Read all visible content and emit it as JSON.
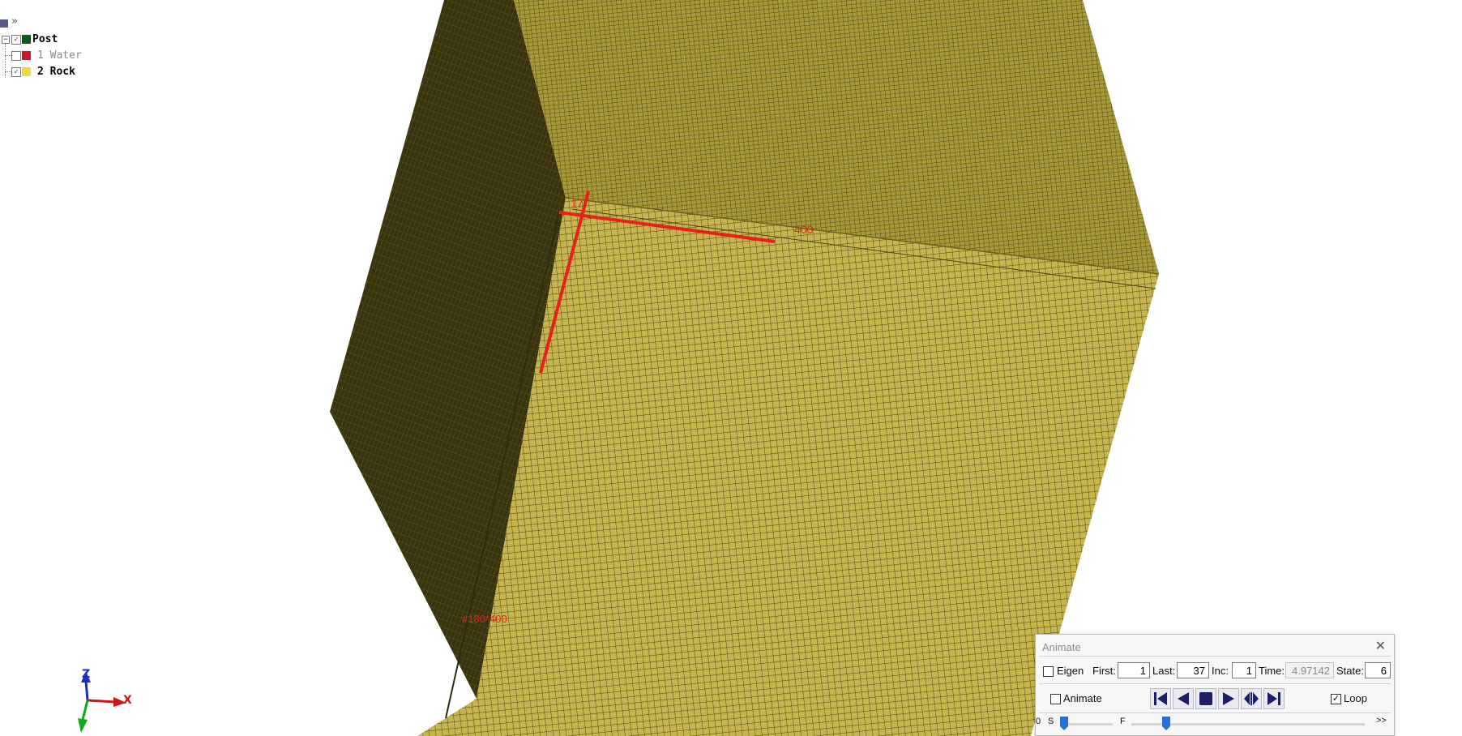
{
  "model_tree": {
    "root": {
      "label": "Post",
      "checked": true,
      "color": "#0a5a10"
    },
    "parts": [
      {
        "label": "1 Water",
        "checked": false,
        "color": "#d01424",
        "visible": false
      },
      {
        "label": "2 Rock",
        "checked": true,
        "color": "#f0dc40",
        "visible": true
      }
    ]
  },
  "annotations": {
    "corner_label": "17",
    "edge_label": "400",
    "bottom_label": "#180*400"
  },
  "axes": {
    "z_label": "Z",
    "x_label": "X",
    "z_color": "#1a2ec8",
    "x_color": "#d01414",
    "y_color": "#12a81a"
  },
  "colors": {
    "mesh_face": "#c6b44e",
    "mesh_face_top": "#9c8e36",
    "mesh_side": "#3d3812",
    "annotation": "#e8201c"
  },
  "animate": {
    "title": "Animate",
    "eigen_label": "Eigen",
    "eigen_checked": false,
    "first_label": "First:",
    "first_value": "1",
    "last_label": "Last:",
    "last_value": "37",
    "inc_label": "Inc:",
    "inc_value": "1",
    "time_label": "Time:",
    "time_value": "4.97142",
    "state_label": "State:",
    "state_value": "6",
    "animate_label": "Animate",
    "animate_checked": false,
    "loop_label": "Loop",
    "loop_checked": true,
    "speed_min_label": "0",
    "slow_label": "S",
    "fast_label": "F",
    "more_label": ">>",
    "speed_slider_fraction": 0.0,
    "frame_slider_fraction": 0.15
  }
}
